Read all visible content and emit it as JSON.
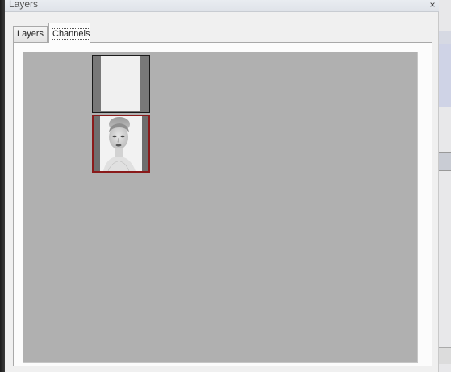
{
  "window": {
    "title": "Layers",
    "close_glyph": "×"
  },
  "tabs": [
    {
      "label": "Layers",
      "active": false
    },
    {
      "label": "Channels",
      "active": true
    }
  ],
  "channels": [
    {
      "name": "blank-channel",
      "selected": false
    },
    {
      "name": "portrait-channel",
      "selected": true
    }
  ],
  "colors": {
    "channel_background": "#b0b0b0",
    "selection_border": "#8a1a1a"
  }
}
